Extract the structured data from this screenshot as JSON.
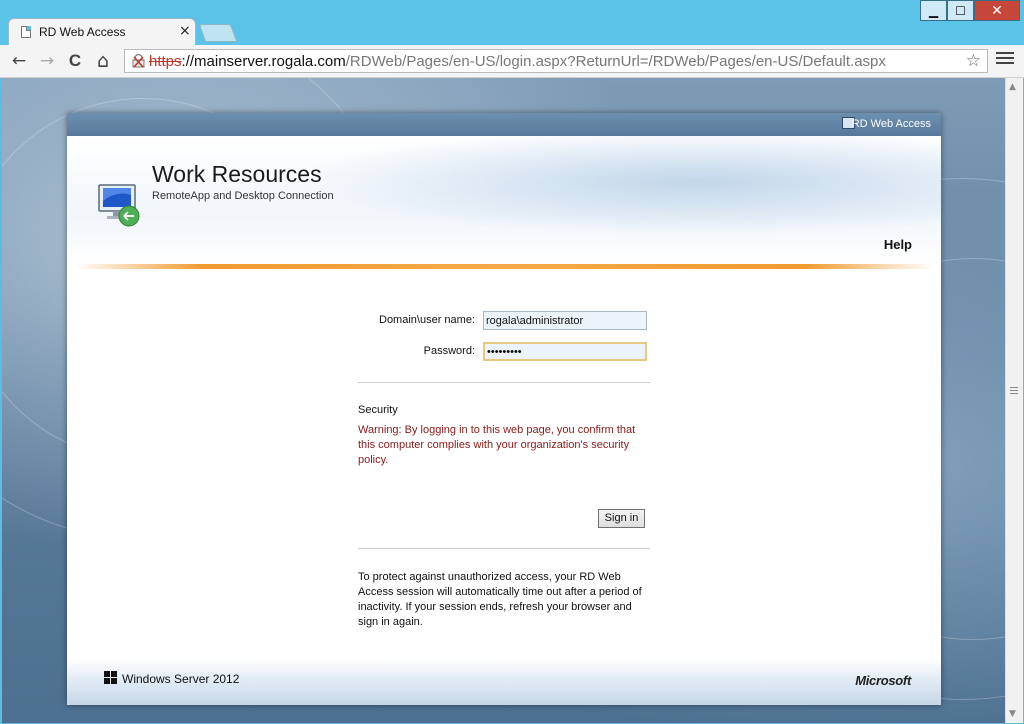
{
  "browser": {
    "tab_title": "RD Web Access",
    "tab_close": "×",
    "url": {
      "scheme": "https",
      "host": "://mainserver.rogala.com",
      "path": "/RDWeb/Pages/en-US/login.aspx?ReturnUrl=/RDWeb/Pages/en-US/Default.aspx"
    },
    "window_buttons": {
      "minimize": "▁",
      "maximize": "☐",
      "close": "✕"
    },
    "nav": {
      "back": "←",
      "forward": "→",
      "reload": "C",
      "home": "⌂",
      "star": "☆"
    }
  },
  "page": {
    "header_label": "RD Web Access",
    "app_title": "Work Resources",
    "app_subtitle": "RemoteApp and Desktop Connection",
    "help_link": "Help",
    "form": {
      "username_label": "Domain\\user name:",
      "username_value": "rogala\\administrator",
      "password_label": "Password:",
      "password_value": "•••••••••"
    },
    "security_title": "Security",
    "security_warning": "Warning: By logging in to this web page, you confirm that this computer complies with your organization's security policy.",
    "signin_label": "Sign in",
    "timeout_note": "To protect against unauthorized access, your RD Web Access session will automatically time out after a period of inactivity. If your session ends, refresh your browser and sign in again.",
    "footer_left": "Windows Server 2012",
    "footer_right": "Microsoft"
  },
  "colors": {
    "chrome_frame": "#5cc3e8",
    "warning_text": "#8b1a1a",
    "accent_rule": "#f19a2e",
    "card_header": "#6d8fae"
  },
  "icons": [
    "page-icon",
    "close-icon",
    "back-arrow-icon",
    "forward-arrow-icon",
    "reload-icon",
    "home-icon",
    "broken-lock-icon",
    "star-icon",
    "menu-icon",
    "remote-desktop-icon",
    "windows-logo-icon"
  ]
}
